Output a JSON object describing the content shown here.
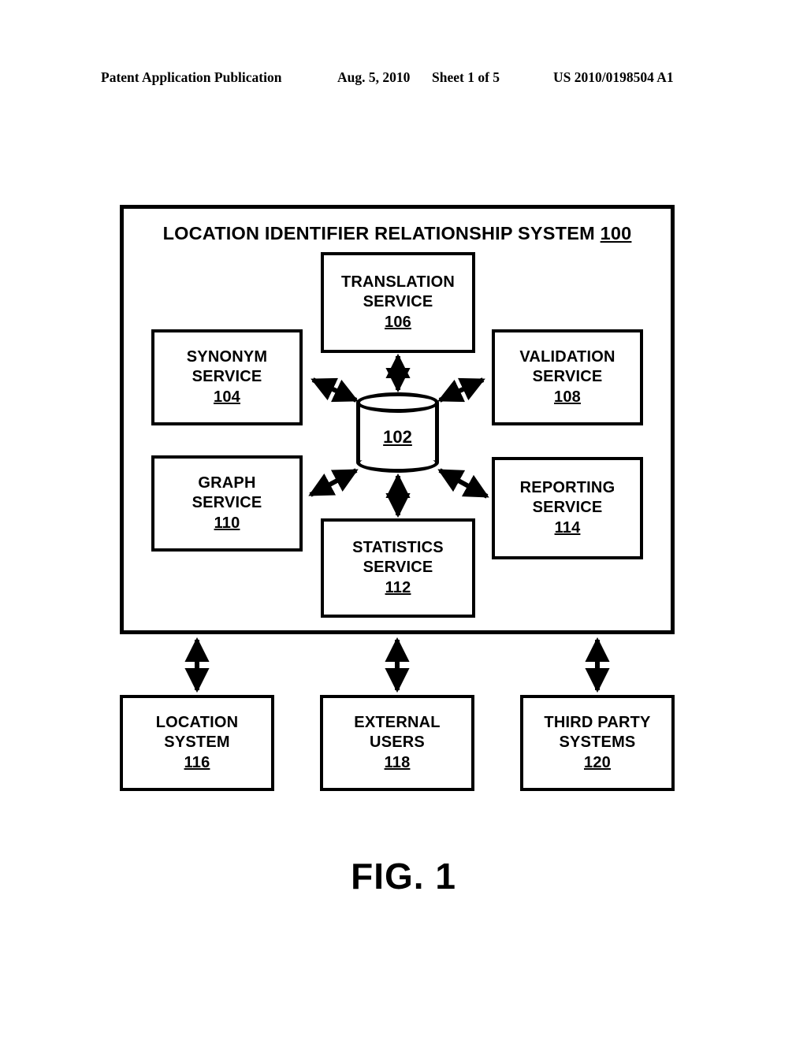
{
  "header": {
    "publication": "Patent Application Publication",
    "date": "Aug. 5, 2010",
    "sheet": "Sheet 1 of 5",
    "patent_number": "US 2010/0198504 A1"
  },
  "figure": {
    "caption": "FIG. 1",
    "system": {
      "title_text": "LOCATION IDENTIFIER RELATIONSHIP SYSTEM",
      "title_ref": "100"
    },
    "database": {
      "ref": "102",
      "icon": "database-cylinder-icon"
    },
    "services": [
      {
        "line1": "TRANSLATION",
        "line2": "SERVICE",
        "ref": "106"
      },
      {
        "line1": "SYNONYM",
        "line2": "SERVICE",
        "ref": "104"
      },
      {
        "line1": "VALIDATION",
        "line2": "SERVICE",
        "ref": "108"
      },
      {
        "line1": "GRAPH",
        "line2": "SERVICE",
        "ref": "110"
      },
      {
        "line1": "REPORTING",
        "line2": "SERVICE",
        "ref": "114"
      },
      {
        "line1": "STATISTICS",
        "line2": "SERVICE",
        "ref": "112"
      }
    ],
    "external_entities": [
      {
        "line1": "LOCATION",
        "line2": "SYSTEM",
        "ref": "116"
      },
      {
        "line1": "EXTERNAL",
        "line2": "USERS",
        "ref": "118"
      },
      {
        "line1": "THIRD PARTY",
        "line2": "SYSTEMS",
        "ref": "120"
      }
    ],
    "connections": [
      {
        "from": "102",
        "to": "106",
        "style": "bidirectional"
      },
      {
        "from": "102",
        "to": "104",
        "style": "bidirectional"
      },
      {
        "from": "102",
        "to": "108",
        "style": "bidirectional"
      },
      {
        "from": "102",
        "to": "110",
        "style": "bidirectional"
      },
      {
        "from": "102",
        "to": "112",
        "style": "bidirectional"
      },
      {
        "from": "102",
        "to": "114",
        "style": "bidirectional"
      },
      {
        "from": "100",
        "to": "116",
        "style": "bidirectional"
      },
      {
        "from": "100",
        "to": "118",
        "style": "bidirectional"
      },
      {
        "from": "100",
        "to": "120",
        "style": "bidirectional"
      }
    ],
    "colors": {
      "ink": "#000000",
      "paper": "#ffffff"
    }
  }
}
